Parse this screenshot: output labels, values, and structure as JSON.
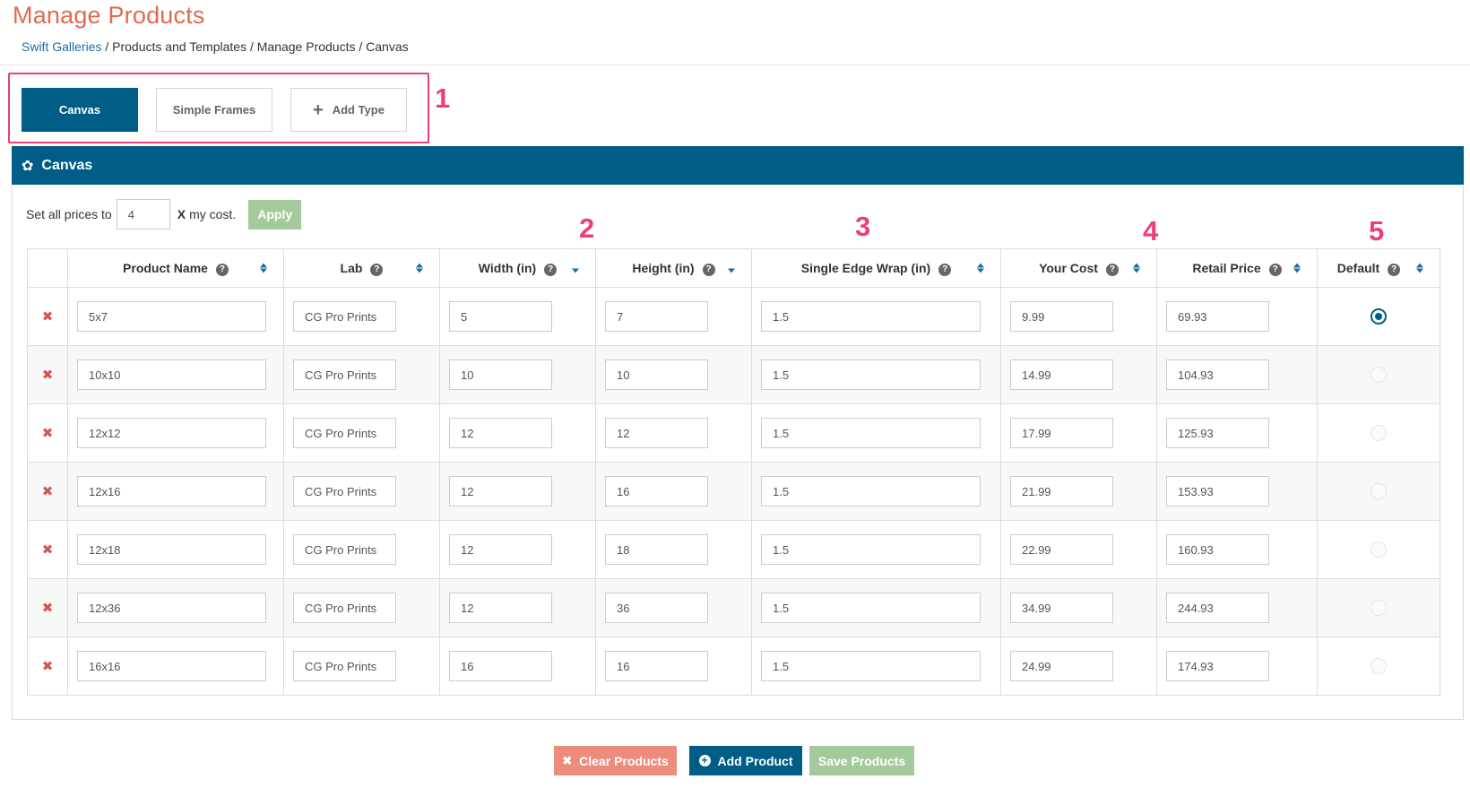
{
  "page": {
    "title": "Manage Products",
    "breadcrumb": {
      "link": "Swift Galleries",
      "rest": "/ Products and Templates / Manage Products / Canvas"
    }
  },
  "annotations": [
    "1",
    "2",
    "3",
    "4",
    "5"
  ],
  "type_tabs": [
    {
      "label": "Canvas",
      "active": true
    },
    {
      "label": "Simple Frames",
      "active": false
    },
    {
      "label": "Add Type",
      "icon": "plus-icon"
    }
  ],
  "panel": {
    "title": "Canvas",
    "icon": "gear-icon",
    "setall_label": "Set all prices to",
    "multiplier_value": "4",
    "x_label": "X",
    "my_cost_label": "my cost.",
    "apply_label": "Apply"
  },
  "columns": [
    "",
    "Product Name",
    "Lab",
    "Width (in)",
    "Height (in)",
    "Single Edge Wrap (in)",
    "Your Cost",
    "Retail Price",
    "Default"
  ],
  "rows": [
    {
      "name": "5x7",
      "lab": "CG Pro Prints",
      "width": "5",
      "height": "7",
      "wrap": "1.5",
      "cost": "9.99",
      "retail": "69.93",
      "default": true
    },
    {
      "name": "10x10",
      "lab": "CG Pro Prints",
      "width": "10",
      "height": "10",
      "wrap": "1.5",
      "cost": "14.99",
      "retail": "104.93",
      "default": false
    },
    {
      "name": "12x12",
      "lab": "CG Pro Prints",
      "width": "12",
      "height": "12",
      "wrap": "1.5",
      "cost": "17.99",
      "retail": "125.93",
      "default": false
    },
    {
      "name": "12x16",
      "lab": "CG Pro Prints",
      "width": "12",
      "height": "16",
      "wrap": "1.5",
      "cost": "21.99",
      "retail": "153.93",
      "default": false
    },
    {
      "name": "12x18",
      "lab": "CG Pro Prints",
      "width": "12",
      "height": "18",
      "wrap": "1.5",
      "cost": "22.99",
      "retail": "160.93",
      "default": false
    },
    {
      "name": "12x36",
      "lab": "CG Pro Prints",
      "width": "12",
      "height": "36",
      "wrap": "1.5",
      "cost": "34.99",
      "retail": "244.93",
      "default": false
    },
    {
      "name": "16x16",
      "lab": "CG Pro Prints",
      "width": "16",
      "height": "16",
      "wrap": "1.5",
      "cost": "24.99",
      "retail": "174.93",
      "default": false
    }
  ],
  "footer": {
    "clear_label": "Clear Products",
    "add_label": "Add Product",
    "save_label": "Save Products"
  },
  "colors": {
    "primary": "#005d86",
    "title": "#e2694f",
    "annotation": "#ec3f78",
    "apply": "#a4ca9b",
    "clear": "#ec8c7c",
    "delete": "#d9534f"
  }
}
